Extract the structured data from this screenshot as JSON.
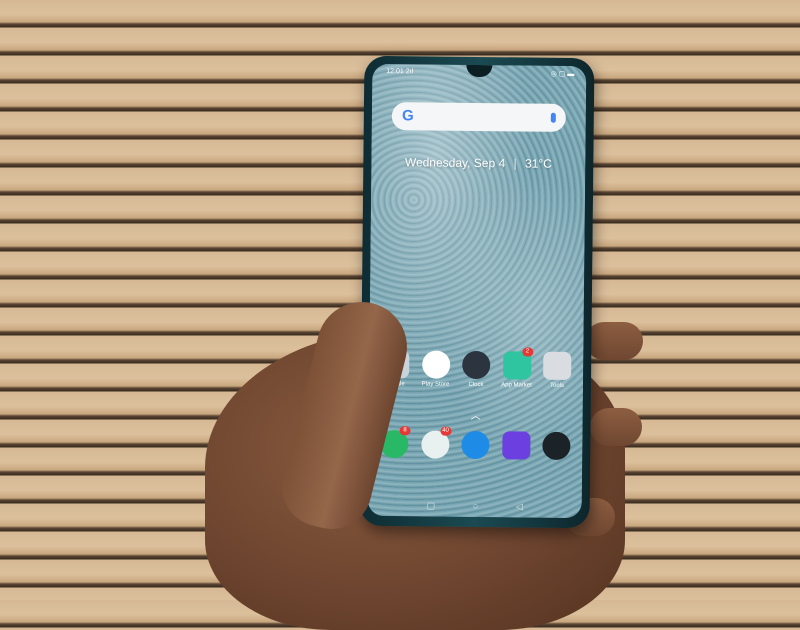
{
  "status_bar": {
    "time": "12:01",
    "signal": "2ıl",
    "icons": "◎ ▢ ▬"
  },
  "search": {
    "logo": "G",
    "mic_icon": "mic-icon"
  },
  "widget": {
    "date": "Wednesday, Sep 4",
    "temperature": "31°C"
  },
  "apps": [
    {
      "label": "Google",
      "color": "#c9d3dc"
    },
    {
      "label": "Play Store",
      "color": "#ffffff"
    },
    {
      "label": "Clock",
      "color": "#2c3440"
    },
    {
      "label": "App Market",
      "color": "#2fc5a0",
      "badge": "2"
    },
    {
      "label": "Tools",
      "color": "#d9dde2"
    }
  ],
  "dock": [
    {
      "name": "phone",
      "color": "#29b865",
      "badge": "8"
    },
    {
      "name": "messages",
      "color": "#e8f1f0",
      "badge": "40"
    },
    {
      "name": "browser",
      "color": "#1e8be6"
    },
    {
      "name": "gallery",
      "color": "#6b3fe0"
    },
    {
      "name": "camera",
      "color": "#1c2328"
    }
  ],
  "nav": {
    "recent": "▢",
    "home": "○",
    "back": "◁"
  }
}
